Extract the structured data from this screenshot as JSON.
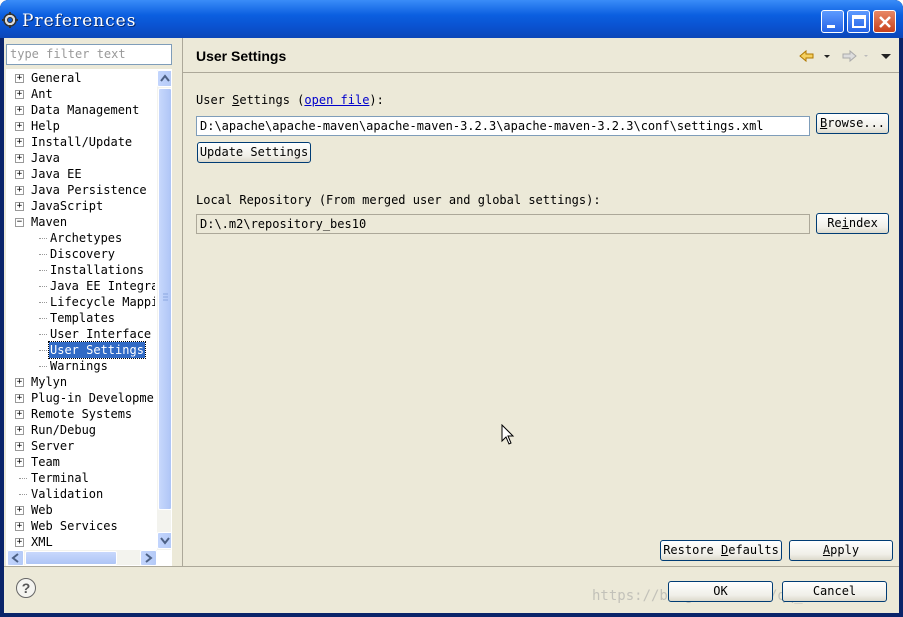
{
  "window": {
    "title": "Preferences",
    "icon": "gear-icon"
  },
  "sidebar": {
    "filter_placeholder": "type filter text",
    "tree": [
      {
        "label": "General",
        "expandable": true,
        "expanded": false,
        "level": 0
      },
      {
        "label": "Ant",
        "expandable": true,
        "expanded": false,
        "level": 0
      },
      {
        "label": "Data Management",
        "expandable": true,
        "expanded": false,
        "level": 0
      },
      {
        "label": "Help",
        "expandable": true,
        "expanded": false,
        "level": 0
      },
      {
        "label": "Install/Update",
        "expandable": true,
        "expanded": false,
        "level": 0
      },
      {
        "label": "Java",
        "expandable": true,
        "expanded": false,
        "level": 0
      },
      {
        "label": "Java EE",
        "expandable": true,
        "expanded": false,
        "level": 0
      },
      {
        "label": "Java Persistence",
        "expandable": true,
        "expanded": false,
        "level": 0
      },
      {
        "label": "JavaScript",
        "expandable": true,
        "expanded": false,
        "level": 0
      },
      {
        "label": "Maven",
        "expandable": true,
        "expanded": true,
        "level": 0
      },
      {
        "label": "Archetypes",
        "expandable": false,
        "level": 1
      },
      {
        "label": "Discovery",
        "expandable": false,
        "level": 1
      },
      {
        "label": "Installations",
        "expandable": false,
        "level": 1
      },
      {
        "label": "Java EE Integra",
        "expandable": false,
        "level": 1
      },
      {
        "label": "Lifecycle Mappi",
        "expandable": false,
        "level": 1
      },
      {
        "label": "Templates",
        "expandable": false,
        "level": 1
      },
      {
        "label": "User Interface",
        "expandable": false,
        "level": 1
      },
      {
        "label": "User Settings",
        "expandable": false,
        "level": 1,
        "selected": true
      },
      {
        "label": "Warnings",
        "expandable": false,
        "level": 1
      },
      {
        "label": "Mylyn",
        "expandable": true,
        "expanded": false,
        "level": 0
      },
      {
        "label": "Plug-in Developmer",
        "expandable": true,
        "expanded": false,
        "level": 0
      },
      {
        "label": "Remote Systems",
        "expandable": true,
        "expanded": false,
        "level": 0
      },
      {
        "label": "Run/Debug",
        "expandable": true,
        "expanded": false,
        "level": 0
      },
      {
        "label": "Server",
        "expandable": true,
        "expanded": false,
        "level": 0
      },
      {
        "label": "Team",
        "expandable": true,
        "expanded": false,
        "level": 0
      },
      {
        "label": "Terminal",
        "expandable": false,
        "level": 0
      },
      {
        "label": "Validation",
        "expandable": false,
        "level": 0
      },
      {
        "label": "Web",
        "expandable": true,
        "expanded": false,
        "level": 0
      },
      {
        "label": "Web Services",
        "expandable": true,
        "expanded": false,
        "level": 0
      },
      {
        "label": "XML",
        "expandable": true,
        "expanded": false,
        "level": 0
      }
    ]
  },
  "main": {
    "title": "User Settings",
    "user_settings_label_pre": "User ",
    "user_settings_label_u": "S",
    "user_settings_label_post": "ettings (",
    "open_file_link": "open file",
    "user_settings_label_end": "):",
    "user_settings_path": "D:\\apache\\apache-maven\\apache-maven-3.2.3\\apache-maven-3.2.3\\conf\\settings.xml",
    "browse_button": "Browse...",
    "update_button": "Update Settings",
    "local_repo_label": "Local Repository (From merged user and global settings):",
    "local_repo_path": "D:\\.m2\\repository_bes10",
    "reindex_button": "Reindex",
    "restore_defaults_button": "Restore Defaults",
    "apply_button": "Apply"
  },
  "footer": {
    "ok_button": "OK",
    "cancel_button": "Cancel",
    "help_icon": "?",
    "watermark": "https://blog.csdn.net/qq_37..."
  },
  "colors": {
    "title_bar": "#0b5fe0",
    "dialog_bg": "#ece9d8",
    "selection": "#316ac5"
  }
}
